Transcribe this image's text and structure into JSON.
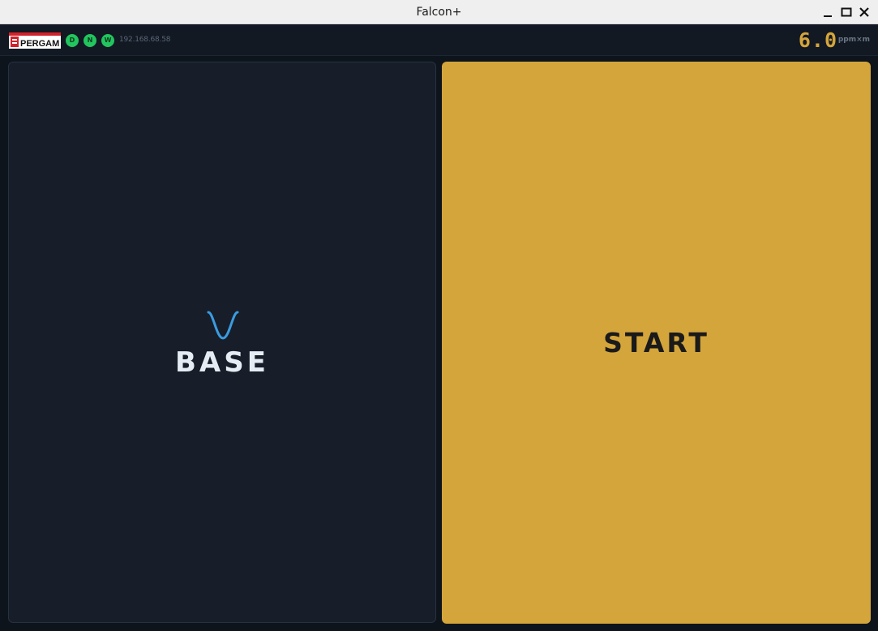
{
  "window": {
    "title": "Falcon+",
    "controls": [
      "minimize-icon",
      "maximize-icon",
      "close-icon"
    ]
  },
  "header": {
    "logo_text": "PERGAM",
    "status_indicators": [
      {
        "label": "D",
        "color": "#22c55e"
      },
      {
        "label": "N",
        "color": "#22c55e"
      },
      {
        "label": "W",
        "color": "#22c55e"
      }
    ],
    "ip_address": "192.168.68.58",
    "reading_value": "6.0",
    "reading_unit": "ppm×m"
  },
  "panels": {
    "base": {
      "label": "BASE",
      "icon": "wave-dip-icon"
    },
    "start": {
      "label": "START"
    }
  },
  "colors": {
    "accent": "#d4a53b",
    "status_ok": "#22c55e",
    "background": "#0e141c",
    "panel": "#171e29",
    "wave": "#3b9be0"
  }
}
